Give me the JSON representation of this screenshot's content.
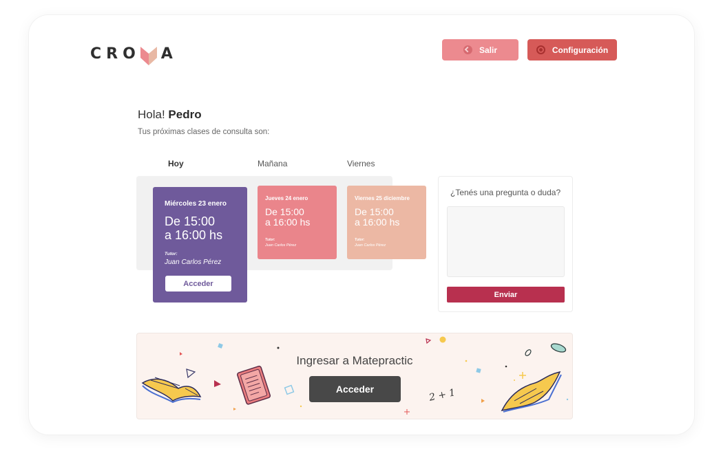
{
  "brand": {
    "logo_text_left": "CRO",
    "logo_text_right": "A"
  },
  "header": {
    "salir_label": "Salir",
    "config_label": "Configuración"
  },
  "greeting": {
    "hello": "Hola!",
    "name": "Pedro",
    "subtitle": "Tus próximas clases de consulta son:"
  },
  "tabs": [
    {
      "label": "Hoy",
      "active": true
    },
    {
      "label": "Mañana",
      "active": false
    },
    {
      "label": "Viernes",
      "active": false
    }
  ],
  "classes": [
    {
      "date": "Miércoles 23 enero",
      "time_from": "De 15:00",
      "time_to": "a 16:00 hs",
      "tutor_label": "Tutor:",
      "tutor": "Juan Carlos Pérez",
      "button": "Acceder",
      "color": "#6f5a9b"
    },
    {
      "date": "Jueves 24 enero",
      "time_from": "De 15:00",
      "time_to": "a 16:00 hs",
      "tutor_label": "Tutor:",
      "tutor": "Juan Carlos Pérez",
      "color": "#ea858b"
    },
    {
      "date": "Viernes 25 diciembre",
      "time_from": "De 15:00",
      "time_to": "a 16:00 hs",
      "tutor_label": "Tutor:",
      "tutor": "Juan Carlos Pérez",
      "color": "#ecb8a4"
    }
  ],
  "question": {
    "title": "¿Tenés una pregunta o duda?",
    "placeholder": "",
    "send_label": "Enviar"
  },
  "banner": {
    "title": "Ingresar a Matepractic",
    "button": "Acceder",
    "math_text": "2 + 1"
  },
  "colors": {
    "salir": "#ec8a8f",
    "config": "#d65a58",
    "send": "#b8304f",
    "banner_bg": "#fcf3ef",
    "banner_btn": "#484848"
  }
}
